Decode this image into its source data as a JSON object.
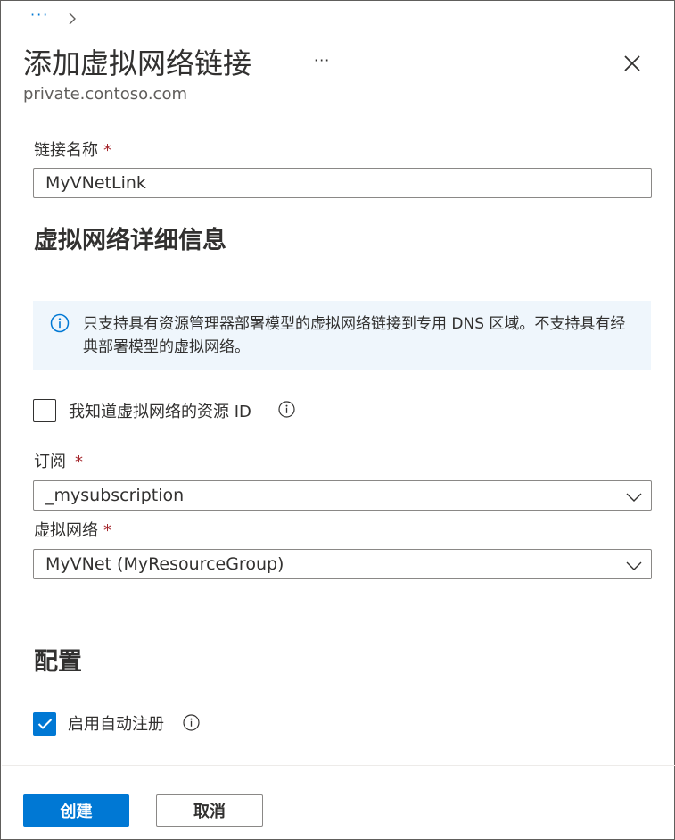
{
  "breadcrumb": {
    "more": "···"
  },
  "header": {
    "title": "添加虚拟网络链接",
    "more": "···",
    "subtitle": "private.contoso.com"
  },
  "link_name": {
    "label": "链接名称",
    "required_mark": "*",
    "value": "MyVNetLink"
  },
  "vnet_details": {
    "heading": "虚拟网络详细信息",
    "info_text": "只支持具有资源管理器部署模型的虚拟网络链接到专用 DNS 区域。不支持具有经典部署模型的虚拟网络。",
    "know_resource_id": {
      "label": "我知道虚拟网络的资源 ID",
      "checked": false
    },
    "subscription": {
      "label": "订阅",
      "required_mark": "*",
      "value": "_mysubscription"
    },
    "virtual_network": {
      "label": "虚拟网络",
      "required_mark": "*",
      "value": "MyVNet (MyResourceGroup)"
    }
  },
  "config": {
    "heading": "配置",
    "auto_registration": {
      "label": "启用自动注册",
      "checked": true
    }
  },
  "footer": {
    "create_label": "创建",
    "cancel_label": "取消"
  },
  "colors": {
    "accent": "#0078d4",
    "required": "#a4262c",
    "info_background": "#eff6fc"
  },
  "icons": [
    "chevron-right-icon",
    "close-icon",
    "info-icon",
    "chevron-down-icon",
    "checkmark-icon"
  ]
}
